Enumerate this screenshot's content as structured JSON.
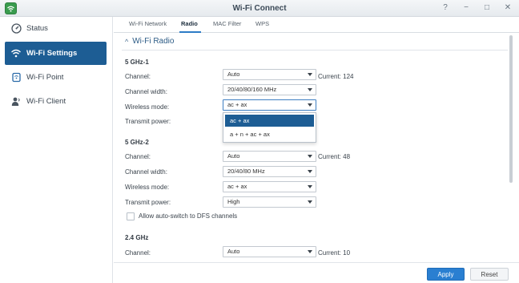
{
  "window": {
    "title": "Wi-Fi Connect",
    "controls": [
      "?",
      "−",
      "□",
      "✕"
    ]
  },
  "sidebar": {
    "items": [
      {
        "label": "Status",
        "icon": "gauge-icon",
        "active": false
      },
      {
        "label": "Wi-Fi Settings",
        "icon": "wifi-icon",
        "active": true
      },
      {
        "label": "Wi-Fi Point",
        "icon": "router-icon",
        "active": false
      },
      {
        "label": "Wi-Fi Client",
        "icon": "user-icon",
        "active": false
      }
    ]
  },
  "tabs": [
    {
      "label": "Wi-Fi Network",
      "active": false
    },
    {
      "label": "Radio",
      "active": true
    },
    {
      "label": "MAC Filter",
      "active": false
    },
    {
      "label": "WPS",
      "active": false
    }
  ],
  "section": {
    "title": "Wi-Fi Radio",
    "chevron": "^"
  },
  "radios": {
    "band1": {
      "name": "5 GHz-1",
      "channel_label": "Channel:",
      "channel_value": "Auto",
      "channel_current": "Current: 124",
      "width_label": "Channel width:",
      "width_value": "20/40/80/160 MHz",
      "mode_label": "Wireless mode:",
      "mode_value": "ac + ax",
      "power_label": "Transmit power:"
    },
    "band2": {
      "name": "5 GHz-2",
      "channel_label": "Channel:",
      "channel_value": "Auto",
      "channel_current": "Current: 48",
      "width_label": "Channel width:",
      "width_value": "20/40/80 MHz",
      "mode_label": "Wireless mode:",
      "mode_value": "ac + ax",
      "power_label": "Transmit power:",
      "power_value": "High"
    },
    "band3": {
      "name": "2.4 GHz",
      "channel_label": "Channel:",
      "channel_value": "Auto",
      "channel_current": "Current: 10"
    }
  },
  "dropdown": {
    "options": [
      "ac + ax",
      "a + n + ac + ax"
    ],
    "selected": "ac + ax"
  },
  "dfs": {
    "label": "Allow auto-switch to DFS channels",
    "checked": false
  },
  "footer": {
    "apply": "Apply",
    "reset": "Reset"
  },
  "colors": {
    "accent": "#1d5d94",
    "apply_button": "#2a7fd1",
    "section_title": "#2d5c86"
  }
}
